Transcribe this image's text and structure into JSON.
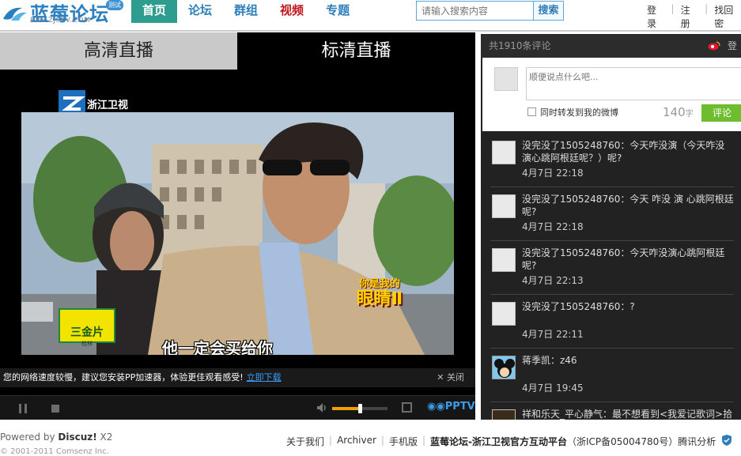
{
  "header": {
    "logo_name": "蓝莓论坛",
    "logo_badge": "测试",
    "logo_sub": "BBS.ZJSTV.COM",
    "nav": [
      {
        "label": "首页",
        "active": true
      },
      {
        "label": "论坛"
      },
      {
        "label": "群组"
      },
      {
        "label": "视频",
        "highlight": "#c0141c"
      },
      {
        "label": "专题"
      }
    ],
    "search_placeholder": "请输入搜索内容",
    "search_button": "搜索",
    "login": "登录",
    "register": "注册",
    "back": "找回密"
  },
  "player": {
    "tab_hd": "高清直播",
    "tab_sd": "标清直播",
    "channel_logo": "浙江卫视",
    "subtitle": "他一定会买给你",
    "show_title_top": "你是我的",
    "show_title_main": "眼睛Ⅱ",
    "sponsor_name": "三金片",
    "sponsor_sub": "桂林",
    "notice_text": "您的网络速度较慢，建议您安装PP加速器，体验更佳观看感受!",
    "notice_link": "立即下载",
    "notice_close": "✕ 关闭",
    "volume": 0.5,
    "brand": "PPTV",
    "accent": "#f0a000"
  },
  "comments": {
    "count_label": "共1910条评论",
    "login": "登录",
    "placeholder": "顺便说点什么吧...",
    "repost_label": "同时转发到我的微博",
    "char_count": "140",
    "char_unit": "字",
    "submit": "评论",
    "items": [
      {
        "text": "没完没了1505248760：今天咋没演（今天咋没演心跳阿根廷呢？）呢?",
        "time": "4月7日 22:18"
      },
      {
        "text": "没完没了1505248760：今天 咋没 演 心跳阿根廷呢?",
        "time": "4月7日 22:18"
      },
      {
        "text": "没完没了1505248760：今天咋没演心跳阿根廷呢?",
        "time": "4月7日 22:13"
      },
      {
        "text": "没完没了1505248760：?",
        "time": "4月7日 22:11"
      },
      {
        "text": "蒋季凯：z46",
        "time": "4月7日 19:45"
      },
      {
        "text": "祥和乐天_平心静气：最不想看到<我爱记歌词>拾",
        "time": ""
      }
    ]
  },
  "footer": {
    "powered_prefix": "Powered by ",
    "powered_brand": "Discuz!",
    "powered_version": " X2",
    "copyright": "© 2001-2011 Comsenz Inc.",
    "links": [
      "关于我们",
      "Archiver",
      "手机版"
    ],
    "site_name": "蓝莓论坛-浙江卫视官方互动平台",
    "icp": "（浙ICP备05004780号）",
    "stats": "腾讯分析"
  }
}
